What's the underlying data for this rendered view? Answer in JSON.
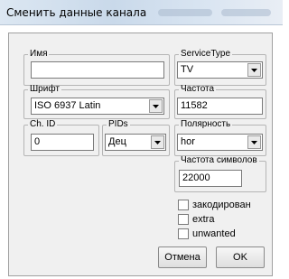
{
  "window": {
    "title": "Сменить данные канала"
  },
  "fields": {
    "name": {
      "label": "Имя",
      "value": ""
    },
    "service_type": {
      "label": "ServiceType",
      "value": "TV"
    },
    "font": {
      "label": "Шрифт",
      "value": "ISO 6937 Latin"
    },
    "frequency": {
      "label": "Частота",
      "value": "11582"
    },
    "ch_id": {
      "label": "Ch. ID",
      "value": "0"
    },
    "pids": {
      "label": "PIDs",
      "value": "Дец"
    },
    "polarity": {
      "label": "Полярность",
      "value": "hor"
    },
    "symbol_rate": {
      "label": "Частота символов",
      "value": "22000"
    }
  },
  "checkboxes": [
    {
      "label": "закодирован",
      "checked": false
    },
    {
      "label": "extra",
      "checked": false
    },
    {
      "label": "unwanted",
      "checked": false
    }
  ],
  "buttons": {
    "cancel": "Отмена",
    "ok": "OK"
  },
  "icons": {
    "dropdown": "chevron-down-icon"
  }
}
